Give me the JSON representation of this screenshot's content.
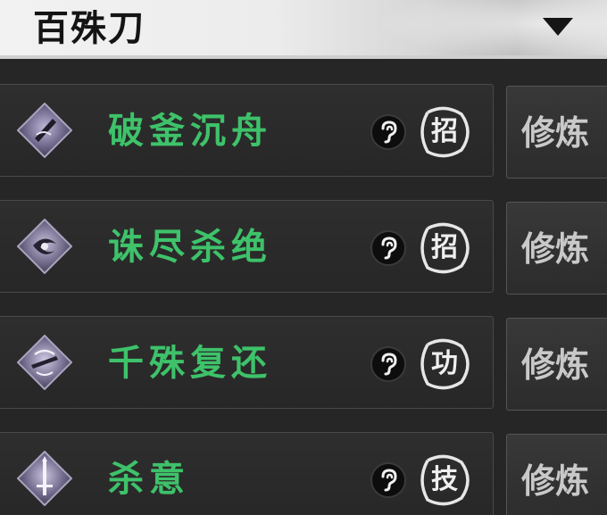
{
  "header": {
    "title": "百殊刀"
  },
  "colors": {
    "skill_name": "#3ec26a",
    "header_bg": "#ececec",
    "panel_bg": "#2a2a2a"
  },
  "skills": [
    {
      "name": "破釜沉舟",
      "type": "招",
      "action": "修炼",
      "icon": "blade-strike-icon"
    },
    {
      "name": "诛尽杀绝",
      "type": "招",
      "action": "修炼",
      "icon": "whirlwind-slash-icon"
    },
    {
      "name": "千殊复还",
      "type": "功",
      "action": "修炼",
      "icon": "returning-blade-icon"
    },
    {
      "name": "杀意",
      "type": "技",
      "action": "修炼",
      "icon": "sword-intent-icon"
    }
  ]
}
